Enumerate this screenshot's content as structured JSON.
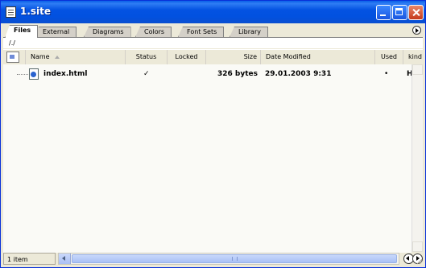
{
  "window": {
    "title": "1.site"
  },
  "tabs": [
    {
      "label": "Files",
      "active": true
    },
    {
      "label": "External",
      "active": false
    },
    {
      "label": "Diagrams",
      "active": false
    },
    {
      "label": "Colors",
      "active": false
    },
    {
      "label": "Font Sets",
      "active": false
    },
    {
      "label": "Library",
      "active": false
    }
  ],
  "path": "/./",
  "columns": {
    "name": "Name",
    "status": "Status",
    "locked": "Locked",
    "size": "Size",
    "date_modified": "Date Modified",
    "used": "Used",
    "kind": "kind"
  },
  "files": [
    {
      "name": "index.html",
      "status": "✓",
      "locked": "",
      "size": "326 bytes",
      "date_modified": "29.01.2003 9:31",
      "used": "•",
      "kind": "H"
    }
  ],
  "status_bar": {
    "text": "1 item"
  },
  "icons": {
    "window": "site-window-icon",
    "file": "html-file-icon",
    "header": "view-options-icon"
  },
  "colors": {
    "titlebar": "#0453e2",
    "window_background": "#ece9d8",
    "scrollbar_thumb": "#c7d7fb"
  }
}
